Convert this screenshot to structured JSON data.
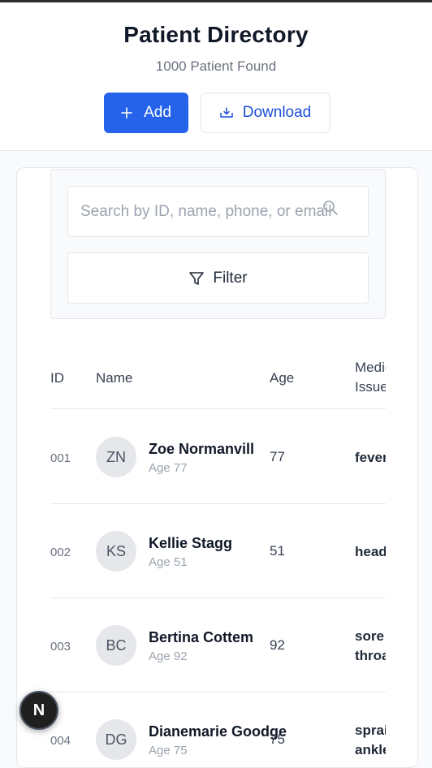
{
  "header": {
    "title": "Patient Directory",
    "subtitle": "1000 Patient Found",
    "add_label": "Add",
    "download_label": "Download"
  },
  "search": {
    "placeholder": "Search by ID, name, phone, or email...",
    "filter_label": "Filter"
  },
  "table": {
    "columns": {
      "id": "ID",
      "name": "Name",
      "age": "Age",
      "medical_issue": "Medical Issue"
    },
    "rows": [
      {
        "id": "001",
        "initials": "ZN",
        "name": "Zoe Normanvill",
        "age_sub": "Age 77",
        "age": "77",
        "med_line1": "fever",
        "med_line2": ""
      },
      {
        "id": "002",
        "initials": "KS",
        "name": "Kellie Stagg",
        "age_sub": "Age 51",
        "age": "51",
        "med_line1": "headache",
        "med_line2": ""
      },
      {
        "id": "003",
        "initials": "BC",
        "name": "Bertina Cottem",
        "age_sub": "Age 92",
        "age": "92",
        "med_line1": "sore",
        "med_line2": "throat"
      },
      {
        "id": "004",
        "initials": "DG",
        "name": "Dianemarie Goodge",
        "age_sub": "Age 75",
        "age": "75",
        "med_line1": "sprained",
        "med_line2": "ankle"
      }
    ]
  },
  "badge": {
    "label": "N"
  },
  "colors": {
    "primary": "#2563eb",
    "border": "#e5e7eb",
    "muted": "#6b7280"
  },
  "icons": {
    "add": "plus-icon",
    "download": "tray-download-icon",
    "search": "magnifier-icon",
    "filter": "funnel-icon"
  }
}
